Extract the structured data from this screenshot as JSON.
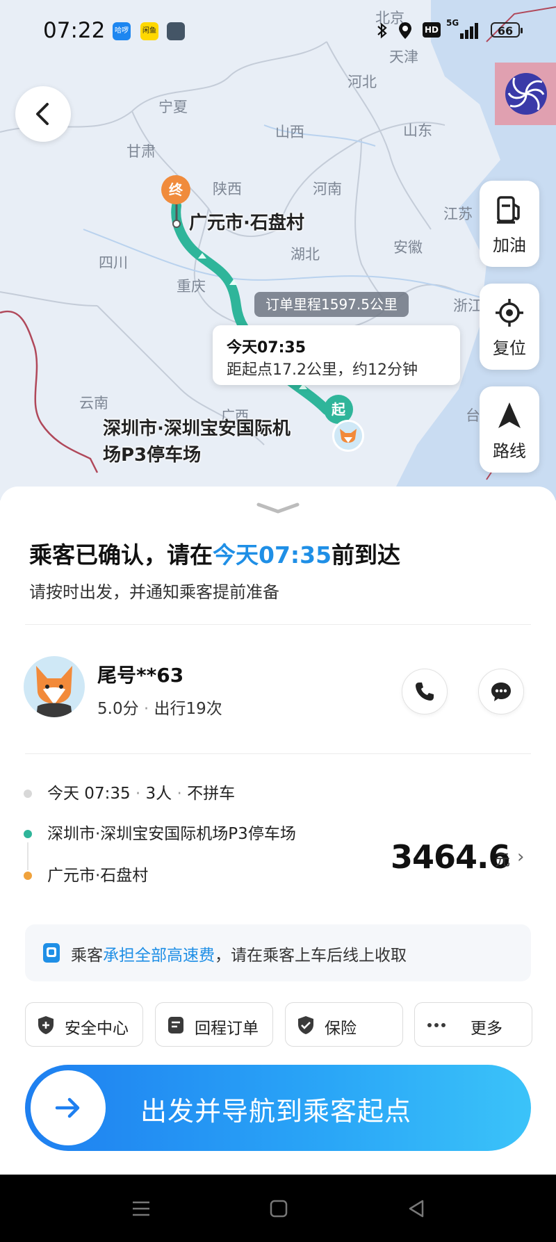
{
  "status_bar": {
    "time": "07:22",
    "apps": [
      "哈啰",
      "闲鱼"
    ],
    "network": "5G",
    "hd": "HD",
    "battery": "66"
  },
  "map": {
    "labels": {
      "beijing": "北京",
      "tianjin": "天津",
      "hebei": "河北",
      "ningxia": "宁夏",
      "shanxi": "山西",
      "shandong": "山东",
      "gansu": "甘肃",
      "shaanxi": "陕西",
      "henan": "河南",
      "jiangsu": "江苏",
      "sichuan": "四川",
      "hubei": "湖北",
      "anhui": "安徽",
      "chongqing": "重庆",
      "zhejiang": "浙江",
      "yunnan": "云南",
      "taiwan": "台",
      "guangxi": "广西"
    },
    "destination": {
      "marker": "终",
      "name": "广元市·石盘村"
    },
    "origin": {
      "marker": "起",
      "name_line1": "深圳市·深圳宝安国际机",
      "name_line2": "场P3停车场"
    },
    "route_distance": "订单里程1597.5公里",
    "eta_card": {
      "time": "今天07:35",
      "detail": "距起点17.2公里，约12分钟"
    },
    "side_buttons": {
      "refuel": "加油",
      "recenter": "复位",
      "route": "路线"
    }
  },
  "sheet": {
    "headline_prefix": "乘客已确认，请在",
    "headline_highlight": "今天07:35",
    "headline_suffix": "前到达",
    "subline": "请按时出发，并通知乘客提前准备",
    "passenger": {
      "name": "尾号**63",
      "rating": "5.0分",
      "trips": "出行19次"
    },
    "trip": {
      "time": "今天 07:35",
      "people": "3人",
      "carpool": "不拼车",
      "from": "深圳市·深圳宝安国际机场P3停车场",
      "to": "广元市·石盘村"
    },
    "price": {
      "amount": "3464.6",
      "unit": "元",
      "arrow": "›"
    },
    "notice": {
      "prefix": "乘客",
      "link": "承担全部高速费",
      "suffix": "，请在乘客上车后线上收取"
    },
    "chips": {
      "safety": "安全中心",
      "return_order": "回程订单",
      "insurance": "保险",
      "more": "更多"
    },
    "go_button": "出发并导航到乘客起点"
  },
  "colors": {
    "accent": "#1f8fe6",
    "route": "#2fb59a",
    "destination": "#f08b3c",
    "origin_dot": "#2fb59a",
    "dest_dot": "#f0a23c"
  }
}
